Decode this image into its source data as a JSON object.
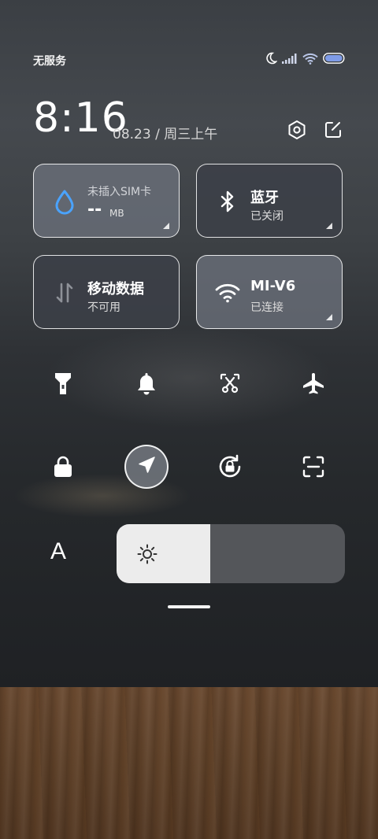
{
  "status_bar": {
    "carrier": "无服务",
    "icons": [
      "moon-icon",
      "signal-icon",
      "wifi-icon",
      "battery-icon"
    ],
    "battery_color": "#7f9ce8"
  },
  "header": {
    "time": "8:16",
    "date": "08.23 / 周三上午",
    "settings_icon": "settings-hexagon-icon",
    "edit_icon": "edit-icon"
  },
  "tiles": [
    {
      "id": "data-usage",
      "title": "未插入SIM卡",
      "value": "--",
      "unit": "MB",
      "icon": "water-drop-icon",
      "accent": "#4aa3ff"
    },
    {
      "id": "bluetooth",
      "title": "蓝牙",
      "subtitle": "已关闭",
      "icon": "bluetooth-icon"
    },
    {
      "id": "mobile-data",
      "title": "移动数据",
      "subtitle": "不可用",
      "icon": "data-arrows-icon"
    },
    {
      "id": "wifi",
      "title": "MI-V6",
      "subtitle": "已连接",
      "icon": "wifi-icon"
    }
  ],
  "quick_row_1": [
    "flashlight-icon",
    "bell-icon",
    "screenshot-scissors-icon",
    "airplane-icon"
  ],
  "quick_row_2": [
    "lock-icon",
    "location-icon",
    "rotation-lock-icon",
    "scan-icon"
  ],
  "brightness": {
    "auto_label": "A",
    "level": 0.41,
    "icon": "sun-icon"
  }
}
